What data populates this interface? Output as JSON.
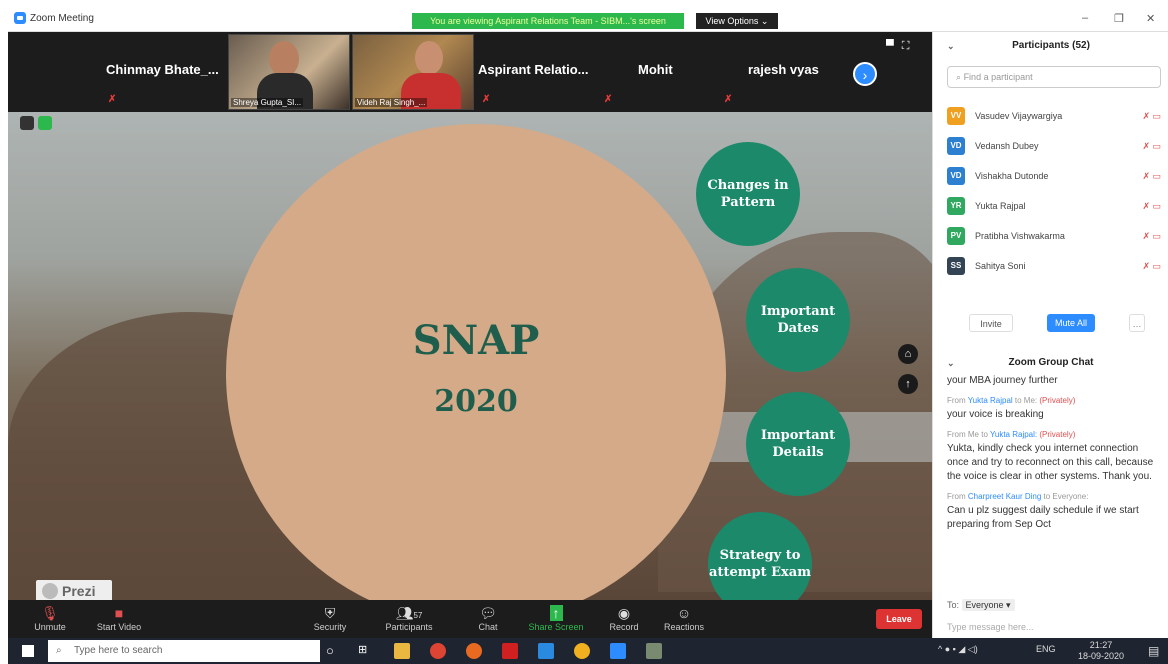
{
  "titlebar": {
    "app_title": "Zoom Meeting",
    "viewing_banner": "You are viewing Aspirant Relations Team - SIBM...'s screen",
    "view_options": "View Options ⌄"
  },
  "strip": {
    "tiles": [
      {
        "name": "Chinmay  Bhate_..."
      },
      {
        "name": "Aspirant  Relatio..."
      },
      {
        "name": "Mohit"
      },
      {
        "name": "rajesh vyas"
      }
    ],
    "videos": [
      {
        "caption": "Shreya Gupta_SI..."
      },
      {
        "caption": "Videh Raj Singh_..."
      }
    ]
  },
  "slide": {
    "title": "SNAP",
    "year": "2020",
    "bubbles": [
      "Changes in Pattern",
      "Important Dates",
      "Important Details",
      "Strategy to attempt Exam"
    ],
    "brand": "Prezi"
  },
  "toolbar": {
    "unmute": "Unmute",
    "start_video": "Start Video",
    "security": "Security",
    "participants": "Participants",
    "participants_count": "57",
    "chat": "Chat",
    "share_screen": "Share Screen",
    "record": "Record",
    "reactions": "Reactions",
    "leave": "Leave"
  },
  "panel": {
    "participants_title": "Participants (52)",
    "find_placeholder": "Find a participant",
    "participants": [
      {
        "initials": "VV",
        "name": "Vasudev Vijaywargiya",
        "color": "#f0a020"
      },
      {
        "initials": "VD",
        "name": "Vedansh Dubey",
        "color": "#2d7fd0"
      },
      {
        "initials": "VD",
        "name": "Vishakha Dutonde",
        "color": "#2d7fd0"
      },
      {
        "initials": "YR",
        "name": "Yukta Rajpal",
        "color": "#30a860"
      },
      {
        "initials": "PV",
        "name": "Pratibha Vishwakarma",
        "color": "#30a860"
      },
      {
        "initials": "SS",
        "name": "Sahitya Soni",
        "color": "#334455"
      }
    ],
    "invite": "Invite",
    "mute_all": "Mute All",
    "chat_title": "Zoom Group Chat",
    "chat": {
      "line0": "your MBA journey further",
      "m1_from": "From",
      "m1_who": "Yukta Rajpal",
      "m1_to": "to Me:",
      "m1_pvt": "(Privately)",
      "m1_text": "your voice is breaking",
      "m2_from": "From Me to",
      "m2_who": "Yukta Rajpal:",
      "m2_pvt": "(Privately)",
      "m2_text": "Yukta, kindly check you internet connection once and try to reconnect on this call, because the voice is clear in other systems. Thank you.",
      "m3_from": "From",
      "m3_who": "Charpreet Kaur Ding",
      "m3_to": "to Everyone:",
      "m3_text": "Can u plz suggest daily schedule if we start preparing from Sep Oct"
    },
    "to_label": "To:",
    "to_value": "Everyone ▾",
    "type_placeholder": "Type message here..."
  },
  "taskbar": {
    "search": "Type here to search",
    "lang": "ENG",
    "time": "21:27",
    "date": "18-09-2020"
  }
}
